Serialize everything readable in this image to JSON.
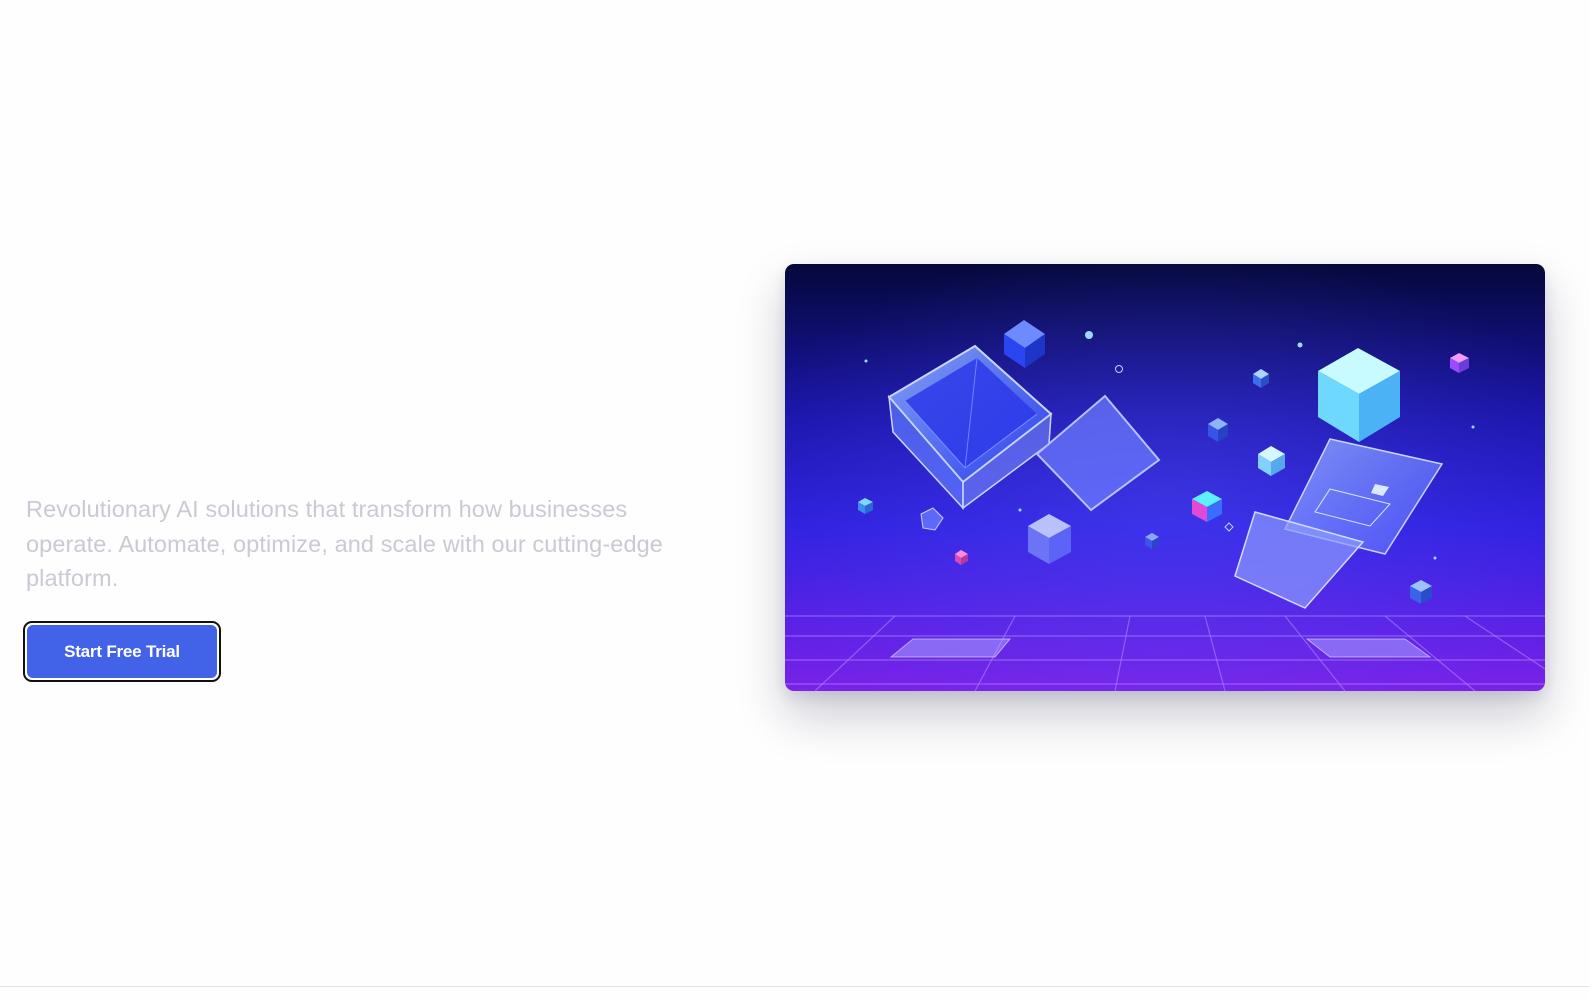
{
  "hero": {
    "description": "Revolutionary AI solutions that transform how businesses operate. Automate, optimize, and scale with our cutting-edge platform.",
    "cta_label": "Start Free Trial"
  },
  "illustration": {
    "icon": "floating-3d-cubes-illustration"
  },
  "colors": {
    "accent": "#4263e8",
    "text_muted": "#c9cad3",
    "gradient_top": "#05083a",
    "gradient_mid": "#2a1fd6",
    "gradient_bottom": "#7a22e8"
  }
}
